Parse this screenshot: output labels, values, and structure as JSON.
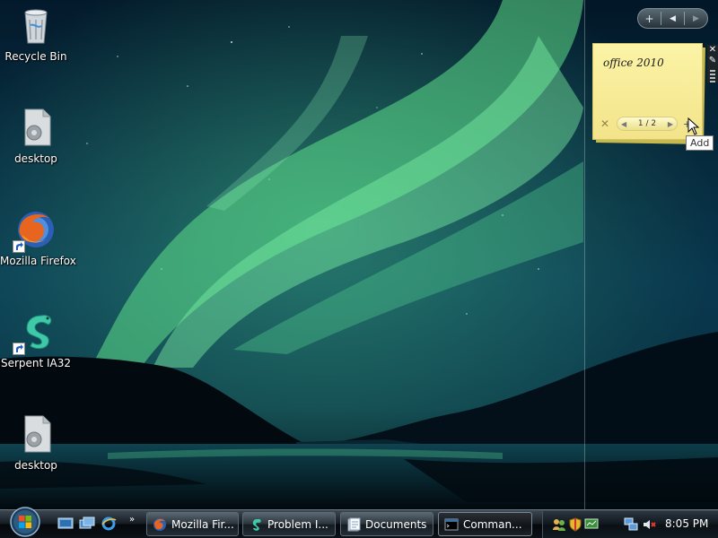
{
  "desktop": {
    "icons": [
      {
        "label": "Recycle Bin",
        "icon": "recycle-bin-icon"
      },
      {
        "label": "desktop",
        "icon": "generic-file-icon"
      },
      {
        "label": "Mozilla Firefox",
        "icon": "firefox-icon",
        "shortcut": true
      },
      {
        "label": "Serpent IA32",
        "icon": "serpent-icon",
        "shortcut": true
      },
      {
        "label": "desktop",
        "icon": "generic-file-icon"
      }
    ]
  },
  "sidebar": {
    "controls": {
      "add": "+",
      "prev": "◀",
      "next": "▶"
    }
  },
  "sticky_note": {
    "text": "office 2010",
    "pager": "1 / 2",
    "delete": "✕",
    "add_tooltip": "Add"
  },
  "taskbar": {
    "quick_launch": [
      "show-desktop-icon",
      "switch-windows-icon",
      "internet-explorer-icon"
    ],
    "more": "»",
    "tasks": [
      {
        "label": "Mozilla Fir...",
        "icon": "firefox-icon"
      },
      {
        "label": "Problem I...",
        "icon": "serpent-icon"
      },
      {
        "label": "Documents",
        "icon": "documents-icon"
      },
      {
        "label": "Comman...",
        "icon": "command-prompt-icon",
        "active": true
      }
    ],
    "tray_icons": [
      "users-icon",
      "security-shield-icon",
      "network-monitor-icon",
      "network-icon",
      "volume-muted-icon"
    ],
    "clock": "8:05 PM"
  },
  "colors": {
    "aurora": "#5fe08a",
    "sticky_note": "#f6e995",
    "taskbar": "#0b1116"
  }
}
